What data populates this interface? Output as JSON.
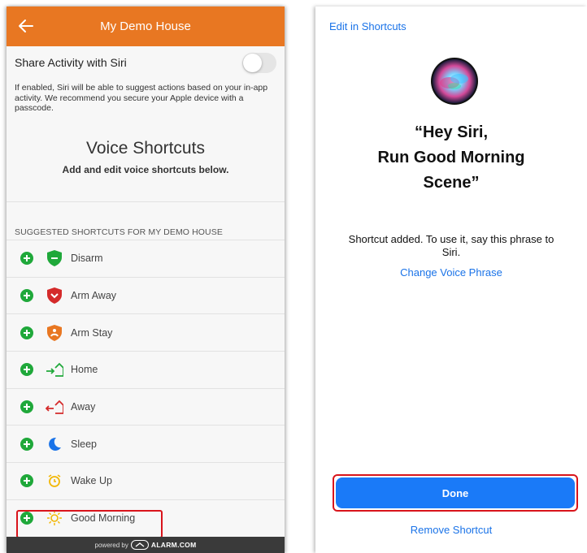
{
  "left": {
    "header": {
      "title": "My Demo House"
    },
    "siri_toggle": {
      "label": "Share Activity with Siri",
      "enabled": false
    },
    "siri_description": "If enabled, Siri will be able to suggest actions based on your in-app activity. We recommend you secure your Apple device with a passcode.",
    "voice_shortcuts": {
      "title": "Voice Shortcuts",
      "subtitle": "Add and edit voice shortcuts below."
    },
    "section_label": "SUGGESTED SHORTCUTS FOR MY DEMO HOUSE",
    "shortcuts": [
      {
        "label": "Disarm",
        "icon": "shield-check-icon",
        "color": "#1fa83a"
      },
      {
        "label": "Arm Away",
        "icon": "shield-away-icon",
        "color": "#d42a2a"
      },
      {
        "label": "Arm Stay",
        "icon": "shield-stay-icon",
        "color": "#e87722"
      },
      {
        "label": "Home",
        "icon": "home-arrive-icon",
        "color": "#1fa83a"
      },
      {
        "label": "Away",
        "icon": "home-leave-icon",
        "color": "#d42a2a"
      },
      {
        "label": "Sleep",
        "icon": "moon-icon",
        "color": "#1a73e8"
      },
      {
        "label": "Wake Up",
        "icon": "alarm-clock-icon",
        "color": "#f2b705"
      },
      {
        "label": "Good Morning",
        "icon": "sun-icon",
        "color": "#f2b705"
      }
    ],
    "footer": {
      "prefix": "powered by",
      "brand": "ALARM.COM"
    }
  },
  "right": {
    "edit_link": "Edit in Shortcuts",
    "phrase_line1": "“Hey Siri,",
    "phrase_line2": "Run Good Morning",
    "phrase_line3": "Scene”",
    "added_text": "Shortcut added. To use it, say this phrase to Siri.",
    "change_link": "Change Voice Phrase",
    "done_label": "Done",
    "remove_link": "Remove Shortcut"
  },
  "colors": {
    "header_orange": "#e87722",
    "ios_blue": "#1a7af8",
    "plus_green": "#1fa83a",
    "highlight_red": "#d9141b"
  }
}
